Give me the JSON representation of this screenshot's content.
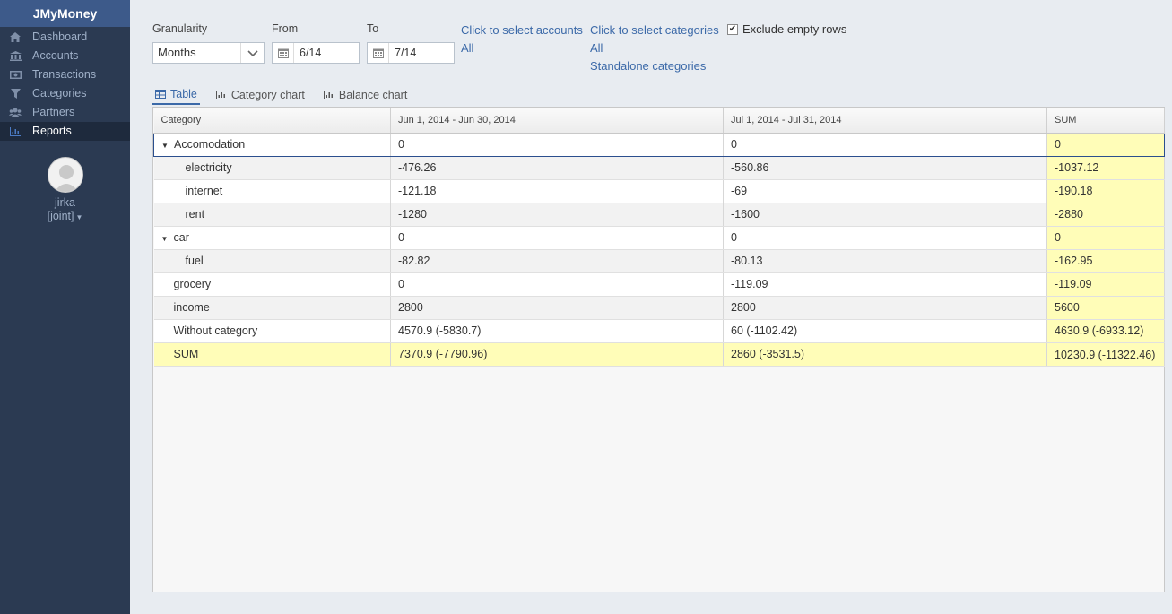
{
  "app": {
    "title": "JMyMoney"
  },
  "nav": [
    {
      "label": "Dashboard",
      "icon": "home-icon",
      "active": false
    },
    {
      "label": "Accounts",
      "icon": "bank-icon",
      "active": false
    },
    {
      "label": "Transactions",
      "icon": "money-icon",
      "active": false
    },
    {
      "label": "Categories",
      "icon": "filter-icon",
      "active": false
    },
    {
      "label": "Partners",
      "icon": "group-icon",
      "active": false
    },
    {
      "label": "Reports",
      "icon": "chart-icon",
      "active": true
    }
  ],
  "user": {
    "name": "jirka",
    "account": "[joint]"
  },
  "filters": {
    "granularity_label": "Granularity",
    "granularity_value": "Months",
    "from_label": "From",
    "from_value": "6/14",
    "to_label": "To",
    "to_value": "7/14",
    "accounts_link": "Click to select accounts",
    "accounts_value": "All",
    "categories_link": "Click to select categories",
    "categories_value": "All",
    "categories_mode": "Standalone categories",
    "exclude_empty_label": "Exclude empty rows",
    "exclude_empty_checked": true
  },
  "tabs": [
    {
      "label": "Table",
      "icon": "table-icon",
      "active": true
    },
    {
      "label": "Category chart",
      "icon": "bar-chart-icon",
      "active": false
    },
    {
      "label": "Balance chart",
      "icon": "bar-chart-icon",
      "active": false
    }
  ],
  "table": {
    "headers": [
      "Category",
      "Jun 1, 2014 - Jun 30, 2014",
      "Jul 1, 2014 - Jul 31, 2014",
      "SUM"
    ],
    "rows": [
      {
        "label": "Accomodation",
        "level": 0,
        "expandable": true,
        "values": [
          "0",
          "0",
          "0"
        ]
      },
      {
        "label": "electricity",
        "level": 1,
        "expandable": false,
        "values": [
          "-476.26",
          "-560.86",
          "-1037.12"
        ]
      },
      {
        "label": "internet",
        "level": 1,
        "expandable": false,
        "values": [
          "-121.18",
          "-69",
          "-190.18"
        ]
      },
      {
        "label": "rent",
        "level": 1,
        "expandable": false,
        "values": [
          "-1280",
          "-1600",
          "-2880"
        ]
      },
      {
        "label": "car",
        "level": 0,
        "expandable": true,
        "values": [
          "0",
          "0",
          "0"
        ]
      },
      {
        "label": "fuel",
        "level": 1,
        "expandable": false,
        "values": [
          "-82.82",
          "-80.13",
          "-162.95"
        ]
      },
      {
        "label": "grocery",
        "level": 0,
        "expandable": false,
        "values": [
          "0",
          "-119.09",
          "-119.09"
        ]
      },
      {
        "label": "income",
        "level": 0,
        "expandable": false,
        "values": [
          "2800",
          "2800",
          "5600"
        ]
      },
      {
        "label": "Without category",
        "level": 0,
        "expandable": false,
        "values": [
          "4570.9 (-5830.7)",
          "60 (-1102.42)",
          "4630.9 (-6933.12)"
        ]
      }
    ],
    "sum_row": {
      "label": "SUM",
      "values": [
        "7370.9 (-7790.96)",
        "2860 (-3531.5)",
        "10230.9 (-11322.46)"
      ]
    }
  }
}
